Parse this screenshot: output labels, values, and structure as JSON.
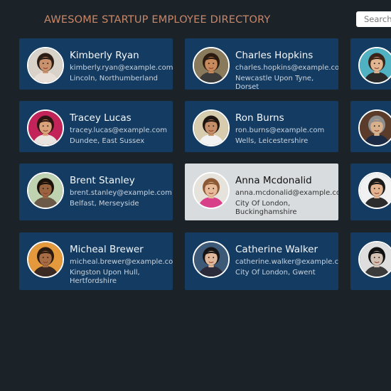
{
  "header": {
    "title": "AWESOME STARTUP EMPLOYEE DIRECTORY",
    "search_placeholder": "Search..."
  },
  "employees": [
    {
      "name": "Kimberly Ryan",
      "email": "kimberly.ryan@example.com",
      "location": "Lincoln, Northumberland",
      "bg": "#d9d2c8",
      "skin": "#c9926e",
      "hair": "#2b1d15",
      "shirt": "#e8e0d8"
    },
    {
      "name": "Charles Hopkins",
      "email": "charles.hopkins@example.com",
      "location": "Newcastle Upon Tyne, Dorset",
      "bg": "#8a7a5c",
      "skin": "#c88a5c",
      "hair": "#2a1a10",
      "shirt": "#3b3b3b"
    },
    {
      "name": "",
      "email": "",
      "location": "",
      "bg": "#4fb1c2",
      "skin": "#e2b592",
      "hair": "#3a2418",
      "shirt": "#2a2a2a"
    },
    {
      "name": "Tracey Lucas",
      "email": "tracey.lucas@example.com",
      "location": "Dundee, East Sussex",
      "bg": "#c2245a",
      "skin": "#d9a27a",
      "hair": "#2a1510",
      "shirt": "#e9e4e0"
    },
    {
      "name": "Ron Burns",
      "email": "ron.burns@example.com",
      "location": "Wells, Leicestershire",
      "bg": "#d8ccae",
      "skin": "#c48e69",
      "hair": "#1e1410",
      "shirt": "#f2f2f2"
    },
    {
      "name": "",
      "email": "",
      "location": "",
      "bg": "#5b3c2a",
      "skin": "#d9b08c",
      "hair": "#8e8e8e",
      "shirt": "#1c2b45"
    },
    {
      "name": "Brent Stanley",
      "email": "brent.stanley@example.com",
      "location": "Belfast, Merseyside",
      "bg": "#bfd3b0",
      "skin": "#9a6440",
      "hair": "#1b120c",
      "shirt": "#6b5a48"
    },
    {
      "name": "Anna Mcdonalid",
      "email": "anna.mcdonalid@example.com",
      "location": "City Of London, Buckinghamshire",
      "bg": "#e6e2dc",
      "skin": "#e7bb9a",
      "hair": "#8c5a35",
      "shirt": "#d8408a"
    },
    {
      "name": "",
      "email": "",
      "location": "",
      "bg": "#f1f1f1",
      "skin": "#e4b490",
      "hair": "#1a1a1a",
      "shirt": "#2c2c2c"
    },
    {
      "name": "Micheal Brewer",
      "email": "micheal.brewer@example.com",
      "location": "Kingston Upon Hull, Hertfordshire",
      "bg": "#e49a3c",
      "skin": "#a66c44",
      "hair": "#2a1a10",
      "shirt": "#3a2a22"
    },
    {
      "name": "Catherine Walker",
      "email": "catherine.walker@example.com",
      "location": "City Of London, Gwent",
      "bg": "#3c5a78",
      "skin": "#e0b79a",
      "hair": "#141414",
      "shirt": "#2a2a3a"
    },
    {
      "name": "",
      "email": "",
      "location": "",
      "bg": "#dedede",
      "skin": "#d3c2b4",
      "hair": "#101010",
      "shirt": "#3a3a3a"
    }
  ]
}
